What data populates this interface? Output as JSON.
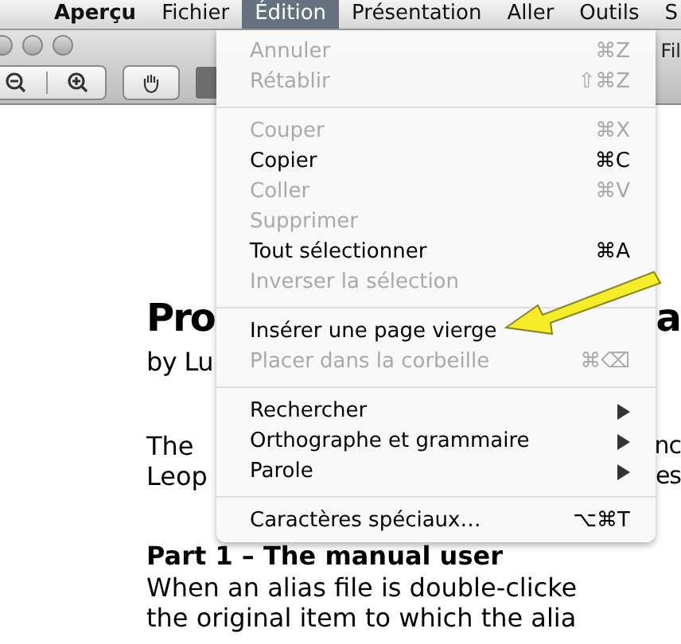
{
  "menu_bar": [
    {
      "label": "Aperçu",
      "kind": "app",
      "selected": false
    },
    {
      "label": "Fichier",
      "kind": "menu",
      "selected": false
    },
    {
      "label": "Édition",
      "kind": "menu",
      "selected": true
    },
    {
      "label": "Présentation",
      "kind": "menu",
      "selected": false
    },
    {
      "label": "Aller",
      "kind": "menu",
      "selected": false
    },
    {
      "label": "Outils",
      "kind": "menu",
      "selected": false
    },
    {
      "label": "S",
      "kind": "menu",
      "selected": false
    }
  ],
  "window": {
    "title_fragment": "Fil"
  },
  "menu": {
    "items": [
      {
        "kind": "item",
        "label": "Annuler",
        "shortcut": "⌘Z",
        "disabled": true
      },
      {
        "kind": "item",
        "label": "Rétablir",
        "shortcut": "⇧⌘Z",
        "disabled": true
      },
      {
        "kind": "separator"
      },
      {
        "kind": "item",
        "label": "Couper",
        "shortcut": "⌘X",
        "disabled": true
      },
      {
        "kind": "item",
        "label": "Copier",
        "shortcut": "⌘C",
        "disabled": false
      },
      {
        "kind": "item",
        "label": "Coller",
        "shortcut": "⌘V",
        "disabled": true
      },
      {
        "kind": "item",
        "label": "Supprimer",
        "disabled": true
      },
      {
        "kind": "item",
        "label": "Tout sélectionner",
        "shortcut": "⌘A",
        "disabled": false
      },
      {
        "kind": "item",
        "label": "Inverser la sélection",
        "disabled": true
      },
      {
        "kind": "separator"
      },
      {
        "kind": "item",
        "label": "Insérer une page vierge",
        "disabled": false
      },
      {
        "kind": "item",
        "label": "Placer dans la corbeille",
        "shortcut": "⌘⌫",
        "disabled": true
      },
      {
        "kind": "separator"
      },
      {
        "kind": "submenu",
        "label": "Rechercher",
        "disabled": false
      },
      {
        "kind": "submenu",
        "label": "Orthographe et grammaire",
        "disabled": false
      },
      {
        "kind": "submenu",
        "label": "Parole",
        "disabled": false
      },
      {
        "kind": "separator"
      },
      {
        "kind": "item",
        "label": "Caractères spéciaux…",
        "shortcut": "⌥⌘T",
        "disabled": false
      }
    ]
  },
  "document": {
    "lines": [
      {
        "kind": "title",
        "left": "Pro",
        "right": "a"
      },
      {
        "kind": "byline",
        "left": "by Lu"
      },
      {
        "kind": "gap"
      },
      {
        "kind": "body",
        "left": "The",
        "right": "nc"
      },
      {
        "kind": "body",
        "left": "Leop",
        "right": "es"
      },
      {
        "kind": "gap"
      },
      {
        "kind": "heading",
        "left": "Part 1 – The manual user"
      },
      {
        "kind": "body",
        "left": "When an alias file is double-clicke"
      },
      {
        "kind": "body",
        "left": "the original item to which the alia"
      }
    ]
  }
}
